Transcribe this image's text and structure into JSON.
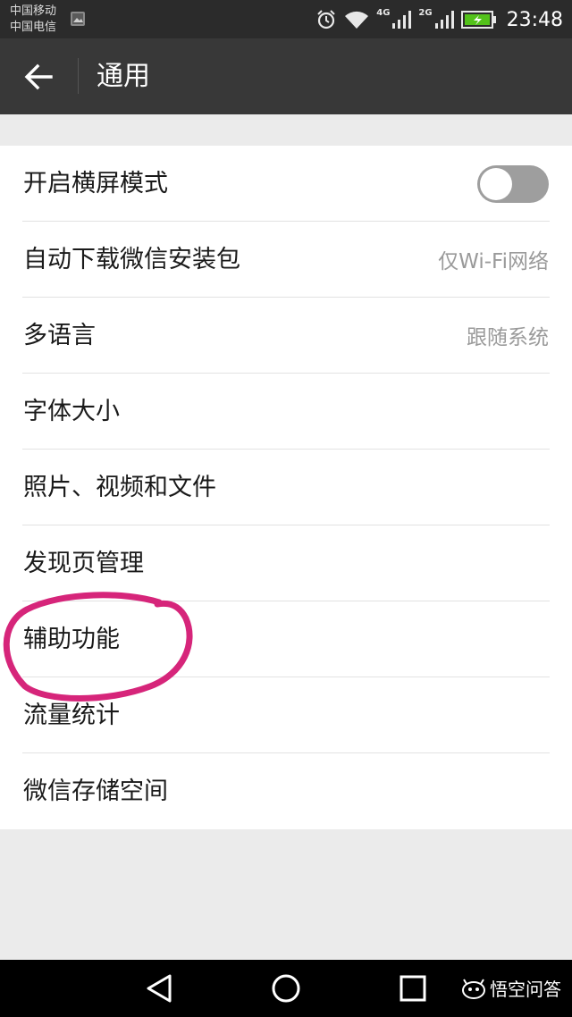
{
  "status_bar": {
    "carrier_1": "中国移动",
    "carrier_2": "中国电信",
    "net_1": "4G",
    "net_2": "2G",
    "time": "23:48",
    "battery_color": "#53c21a",
    "icons": [
      "gallery-icon",
      "alarm-icon",
      "wifi-icon",
      "signal-icon",
      "signal-icon",
      "battery-charging-icon"
    ]
  },
  "header": {
    "title": "通用",
    "back_icon": "arrow-left-icon"
  },
  "settings": {
    "landscape": {
      "label": "开启横屏模式",
      "toggle_on": false
    },
    "auto_download": {
      "label": "自动下载微信安装包",
      "value": "仅Wi-Fi网络"
    },
    "language": {
      "label": "多语言",
      "value": "跟随系统"
    },
    "font_size": {
      "label": "字体大小"
    },
    "media": {
      "label": "照片、视频和文件"
    },
    "discover": {
      "label": "发现页管理"
    },
    "accessibility": {
      "label": "辅助功能"
    },
    "traffic": {
      "label": "流量统计"
    },
    "storage": {
      "label": "微信存储空间"
    }
  },
  "annotation": {
    "color": "#d6257a"
  },
  "nav_bar": {
    "icons": [
      "back-triangle-icon",
      "home-circle-icon",
      "recents-square-icon"
    ]
  },
  "watermark": {
    "text": "悟空问答"
  }
}
